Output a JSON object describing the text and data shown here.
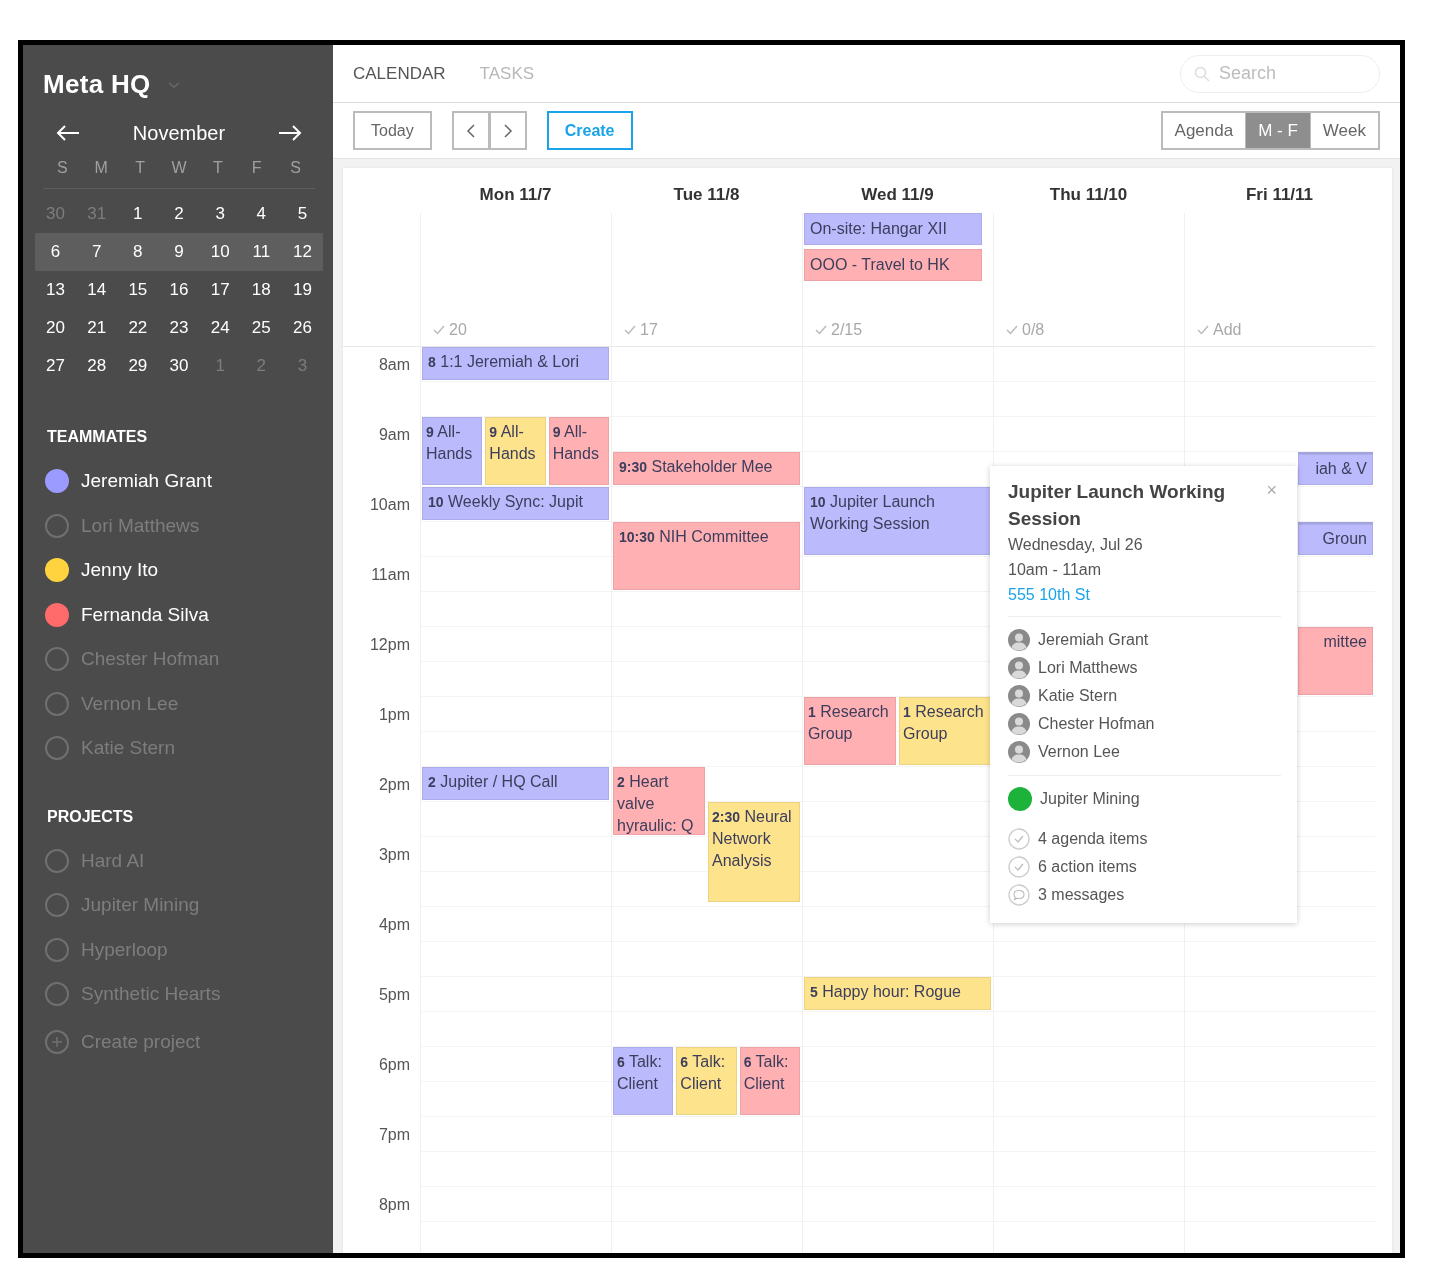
{
  "sidebar": {
    "title": "Meta HQ",
    "month": "November",
    "weekdays": [
      "S",
      "M",
      "T",
      "W",
      "T",
      "F",
      "S"
    ],
    "weeks": [
      {
        "selected": false,
        "days": [
          {
            "label": "30",
            "muted": true
          },
          {
            "label": "31",
            "muted": true
          },
          {
            "label": "1",
            "muted": false
          },
          {
            "label": "2",
            "muted": false
          },
          {
            "label": "3",
            "muted": false
          },
          {
            "label": "4",
            "muted": false
          },
          {
            "label": "5",
            "muted": false
          }
        ]
      },
      {
        "selected": true,
        "days": [
          {
            "label": "6",
            "muted": false
          },
          {
            "label": "7",
            "muted": false
          },
          {
            "label": "8",
            "muted": false
          },
          {
            "label": "9",
            "muted": false
          },
          {
            "label": "10",
            "muted": false
          },
          {
            "label": "11",
            "muted": false
          },
          {
            "label": "12",
            "muted": false
          }
        ]
      },
      {
        "selected": false,
        "days": [
          {
            "label": "13",
            "muted": false
          },
          {
            "label": "14",
            "muted": false
          },
          {
            "label": "15",
            "muted": false
          },
          {
            "label": "16",
            "muted": false
          },
          {
            "label": "17",
            "muted": false
          },
          {
            "label": "18",
            "muted": false
          },
          {
            "label": "19",
            "muted": false
          }
        ]
      },
      {
        "selected": false,
        "days": [
          {
            "label": "20",
            "muted": false
          },
          {
            "label": "21",
            "muted": false
          },
          {
            "label": "22",
            "muted": false
          },
          {
            "label": "23",
            "muted": false
          },
          {
            "label": "24",
            "muted": false
          },
          {
            "label": "25",
            "muted": false
          },
          {
            "label": "26",
            "muted": false
          }
        ]
      },
      {
        "selected": false,
        "days": [
          {
            "label": "27",
            "muted": false
          },
          {
            "label": "28",
            "muted": false
          },
          {
            "label": "29",
            "muted": false
          },
          {
            "label": "30",
            "muted": false
          },
          {
            "label": "1",
            "muted": true
          },
          {
            "label": "2",
            "muted": true
          },
          {
            "label": "3",
            "muted": true
          }
        ]
      }
    ],
    "teammates_heading": "TEAMMATES",
    "teammates": [
      {
        "name": "Jeremiah Grant",
        "on": true,
        "color": "#9b9bff"
      },
      {
        "name": "Lori Matthews",
        "on": false
      },
      {
        "name": "Jenny Ito",
        "on": true,
        "color": "#ffd23f"
      },
      {
        "name": "Fernanda Silva",
        "on": true,
        "color": "#ff6b6b"
      },
      {
        "name": "Chester Hofman",
        "on": false
      },
      {
        "name": "Vernon Lee",
        "on": false
      },
      {
        "name": "Katie Stern",
        "on": false
      }
    ],
    "projects_heading": "PROJECTS",
    "projects": [
      {
        "kind": "project",
        "name": "Hard AI",
        "on": false
      },
      {
        "kind": "project",
        "name": "Jupiter Mining",
        "on": false
      },
      {
        "kind": "project",
        "name": "Hyperloop",
        "on": false
      },
      {
        "kind": "project",
        "name": "Synthetic Hearts",
        "on": false
      },
      {
        "kind": "create",
        "name": "Create project",
        "on": false
      }
    ]
  },
  "tabs": [
    {
      "label": "CALENDAR",
      "selected": true
    },
    {
      "label": "TASKS",
      "selected": false
    }
  ],
  "search": {
    "placeholder": "Search"
  },
  "toolbar": {
    "today": "Today",
    "create": "Create",
    "views": [
      {
        "label": "Agenda",
        "selected": false
      },
      {
        "label": "M - F",
        "selected": true
      },
      {
        "label": "Week",
        "selected": false
      }
    ]
  },
  "hours": [
    {
      "label": "8am"
    },
    {
      "label": "9am",
      "right_edge_events": [
        {
          "title": "iah & V",
          "color": "#babafc",
          "half_past": true,
          "short": true,
          "tall": false
        }
      ]
    },
    {
      "label": "10am",
      "right_edge_events": [
        {
          "title": "Groun",
          "color": "#babafc",
          "half_past": true,
          "short": true,
          "tall": false
        }
      ]
    },
    {
      "label": "11am"
    },
    {
      "label": "12pm",
      "right_edge_events": [
        {
          "title": "mittee",
          "color": "#ffb0b3",
          "half_past": false,
          "short": false,
          "tall": false
        }
      ]
    },
    {
      "label": "1pm"
    },
    {
      "label": "2pm"
    },
    {
      "label": "3pm"
    },
    {
      "label": "4pm"
    },
    {
      "label": "5pm"
    },
    {
      "label": "6pm"
    },
    {
      "label": "7pm"
    },
    {
      "label": "8pm"
    }
  ],
  "days": [
    {
      "label": "Mon 11/7",
      "count": "20",
      "groups": [
        {
          "kind": "columns",
          "events": [
            {
              "time": "8",
              "title": "1:1 Jeremiah & Lori",
              "color": "#babafc",
              "short": true,
              "tall": false
            }
          ]
        },
        {
          "kind": "columns",
          "events": [
            {
              "time": "9",
              "title": "All-Hands",
              "color": "#babafc",
              "short": false,
              "tall": false
            },
            {
              "time": "9",
              "title": "All-Hands",
              "color": "#fde48c",
              "short": false,
              "tall": false
            },
            {
              "time": "9",
              "title": "All-Hands",
              "color": "#ffb0b3",
              "short": false,
              "tall": false
            }
          ]
        },
        {
          "kind": "columns",
          "events": [
            {
              "time": "10",
              "title": "Weekly Sync: Jupit",
              "color": "#babafc",
              "short": true,
              "tall": false
            }
          ]
        },
        {
          "kind": "columns",
          "events": [
            {
              "time": "2",
              "title": "Jupiter / HQ Call",
              "color": "#babafc",
              "short": true,
              "tall": false
            }
          ]
        }
      ]
    },
    {
      "label": "Tue 11/8",
      "count": "17",
      "groups": [
        {
          "kind": "columns",
          "events": [
            {
              "time": "9:30",
              "title": "Stakeholder Mee",
              "color": "#ffb0b3",
              "short": true,
              "tall": false
            }
          ]
        },
        {
          "kind": "columns",
          "events": [
            {
              "time": "10:30",
              "title": "NIH Committee",
              "color": "#ffb0b3",
              "short": false,
              "tall": false
            }
          ]
        },
        {
          "kind": "columns",
          "events": [
            {
              "time": "2",
              "title": "Heart valve hyraulic: Q",
              "color": "#ffb0b3",
              "short": false,
              "tall": false
            },
            {
              "time": "2:30",
              "title": "Neural Network Analysis",
              "color": "#fde48c",
              "short": false,
              "tall": true
            }
          ]
        },
        {
          "kind": "columns",
          "events": [
            {
              "time": "6",
              "title": "Talk: Client",
              "color": "#babafc",
              "short": false,
              "tall": false
            },
            {
              "time": "6",
              "title": "Talk: Client",
              "color": "#fde48c",
              "short": false,
              "tall": false
            },
            {
              "time": "6",
              "title": "Talk: Client",
              "color": "#ffb0b3",
              "short": false,
              "tall": false
            }
          ]
        }
      ]
    },
    {
      "label": "Wed 11/9",
      "all_day": [
        {
          "title": "On-site: Hangar XII",
          "color": "#babafc"
        },
        {
          "title": "OOO - Travel to HK",
          "color": "#ffb0b3"
        }
      ],
      "count": "2/15",
      "groups": [
        {
          "kind": "columns",
          "events": [
            {
              "time": "10",
              "title": "Jupiter Launch Working Session",
              "color": "#babafc",
              "short": false,
              "tall": false
            }
          ]
        },
        {
          "kind": "columns",
          "events": [
            {
              "time": "1",
              "title": "Research Group",
              "color": "#ffb0b3",
              "short": false,
              "tall": false
            },
            {
              "time": "1",
              "title": "Research Group",
              "color": "#fde48c",
              "short": false,
              "tall": false
            }
          ]
        },
        {
          "kind": "columns",
          "events": [
            {
              "time": "5",
              "title": "Happy hour: Rogue",
              "color": "#fde48c",
              "short": true,
              "tall": false
            }
          ]
        }
      ]
    },
    {
      "label": "Thu 11/10",
      "count": "0/8"
    },
    {
      "label": "Fri 11/11",
      "count": "Add"
    }
  ],
  "popover": {
    "title": "Jupiter Launch Working Session",
    "close": "×",
    "date": "Wednesday, Jul 26",
    "time": "10am - 11am",
    "location": "555 10th St",
    "attendees": [
      "Jeremiah Grant",
      "Lori Matthews",
      "Katie Stern",
      "Chester Hofman",
      "Vernon Lee"
    ],
    "project": {
      "name": "Jupiter Mining",
      "color": "#1db33a"
    },
    "items": [
      {
        "kind": "check",
        "label": "4 agenda items"
      },
      {
        "kind": "check",
        "label": "6 action items"
      },
      {
        "kind": "message",
        "label": "3 messages"
      }
    ]
  }
}
